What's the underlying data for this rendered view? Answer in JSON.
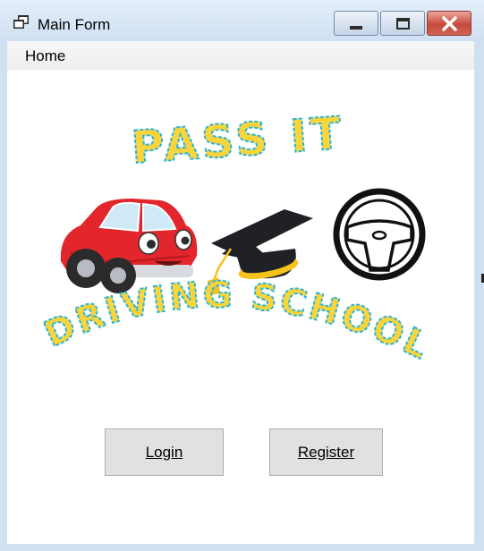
{
  "window": {
    "title": "Main Form"
  },
  "menu": {
    "home_label": "Home"
  },
  "logo": {
    "headline": "PASS IT",
    "subline": "DRIVING SCHOOL"
  },
  "buttons": {
    "login_label": "Login",
    "register_label": "Register"
  },
  "colors": {
    "logo_yellow": "#f9d43a",
    "logo_outline": "#2fb4d6",
    "car_red": "#e2262b",
    "cap_black": "#1f2126",
    "close_red": "#c74a3c"
  }
}
